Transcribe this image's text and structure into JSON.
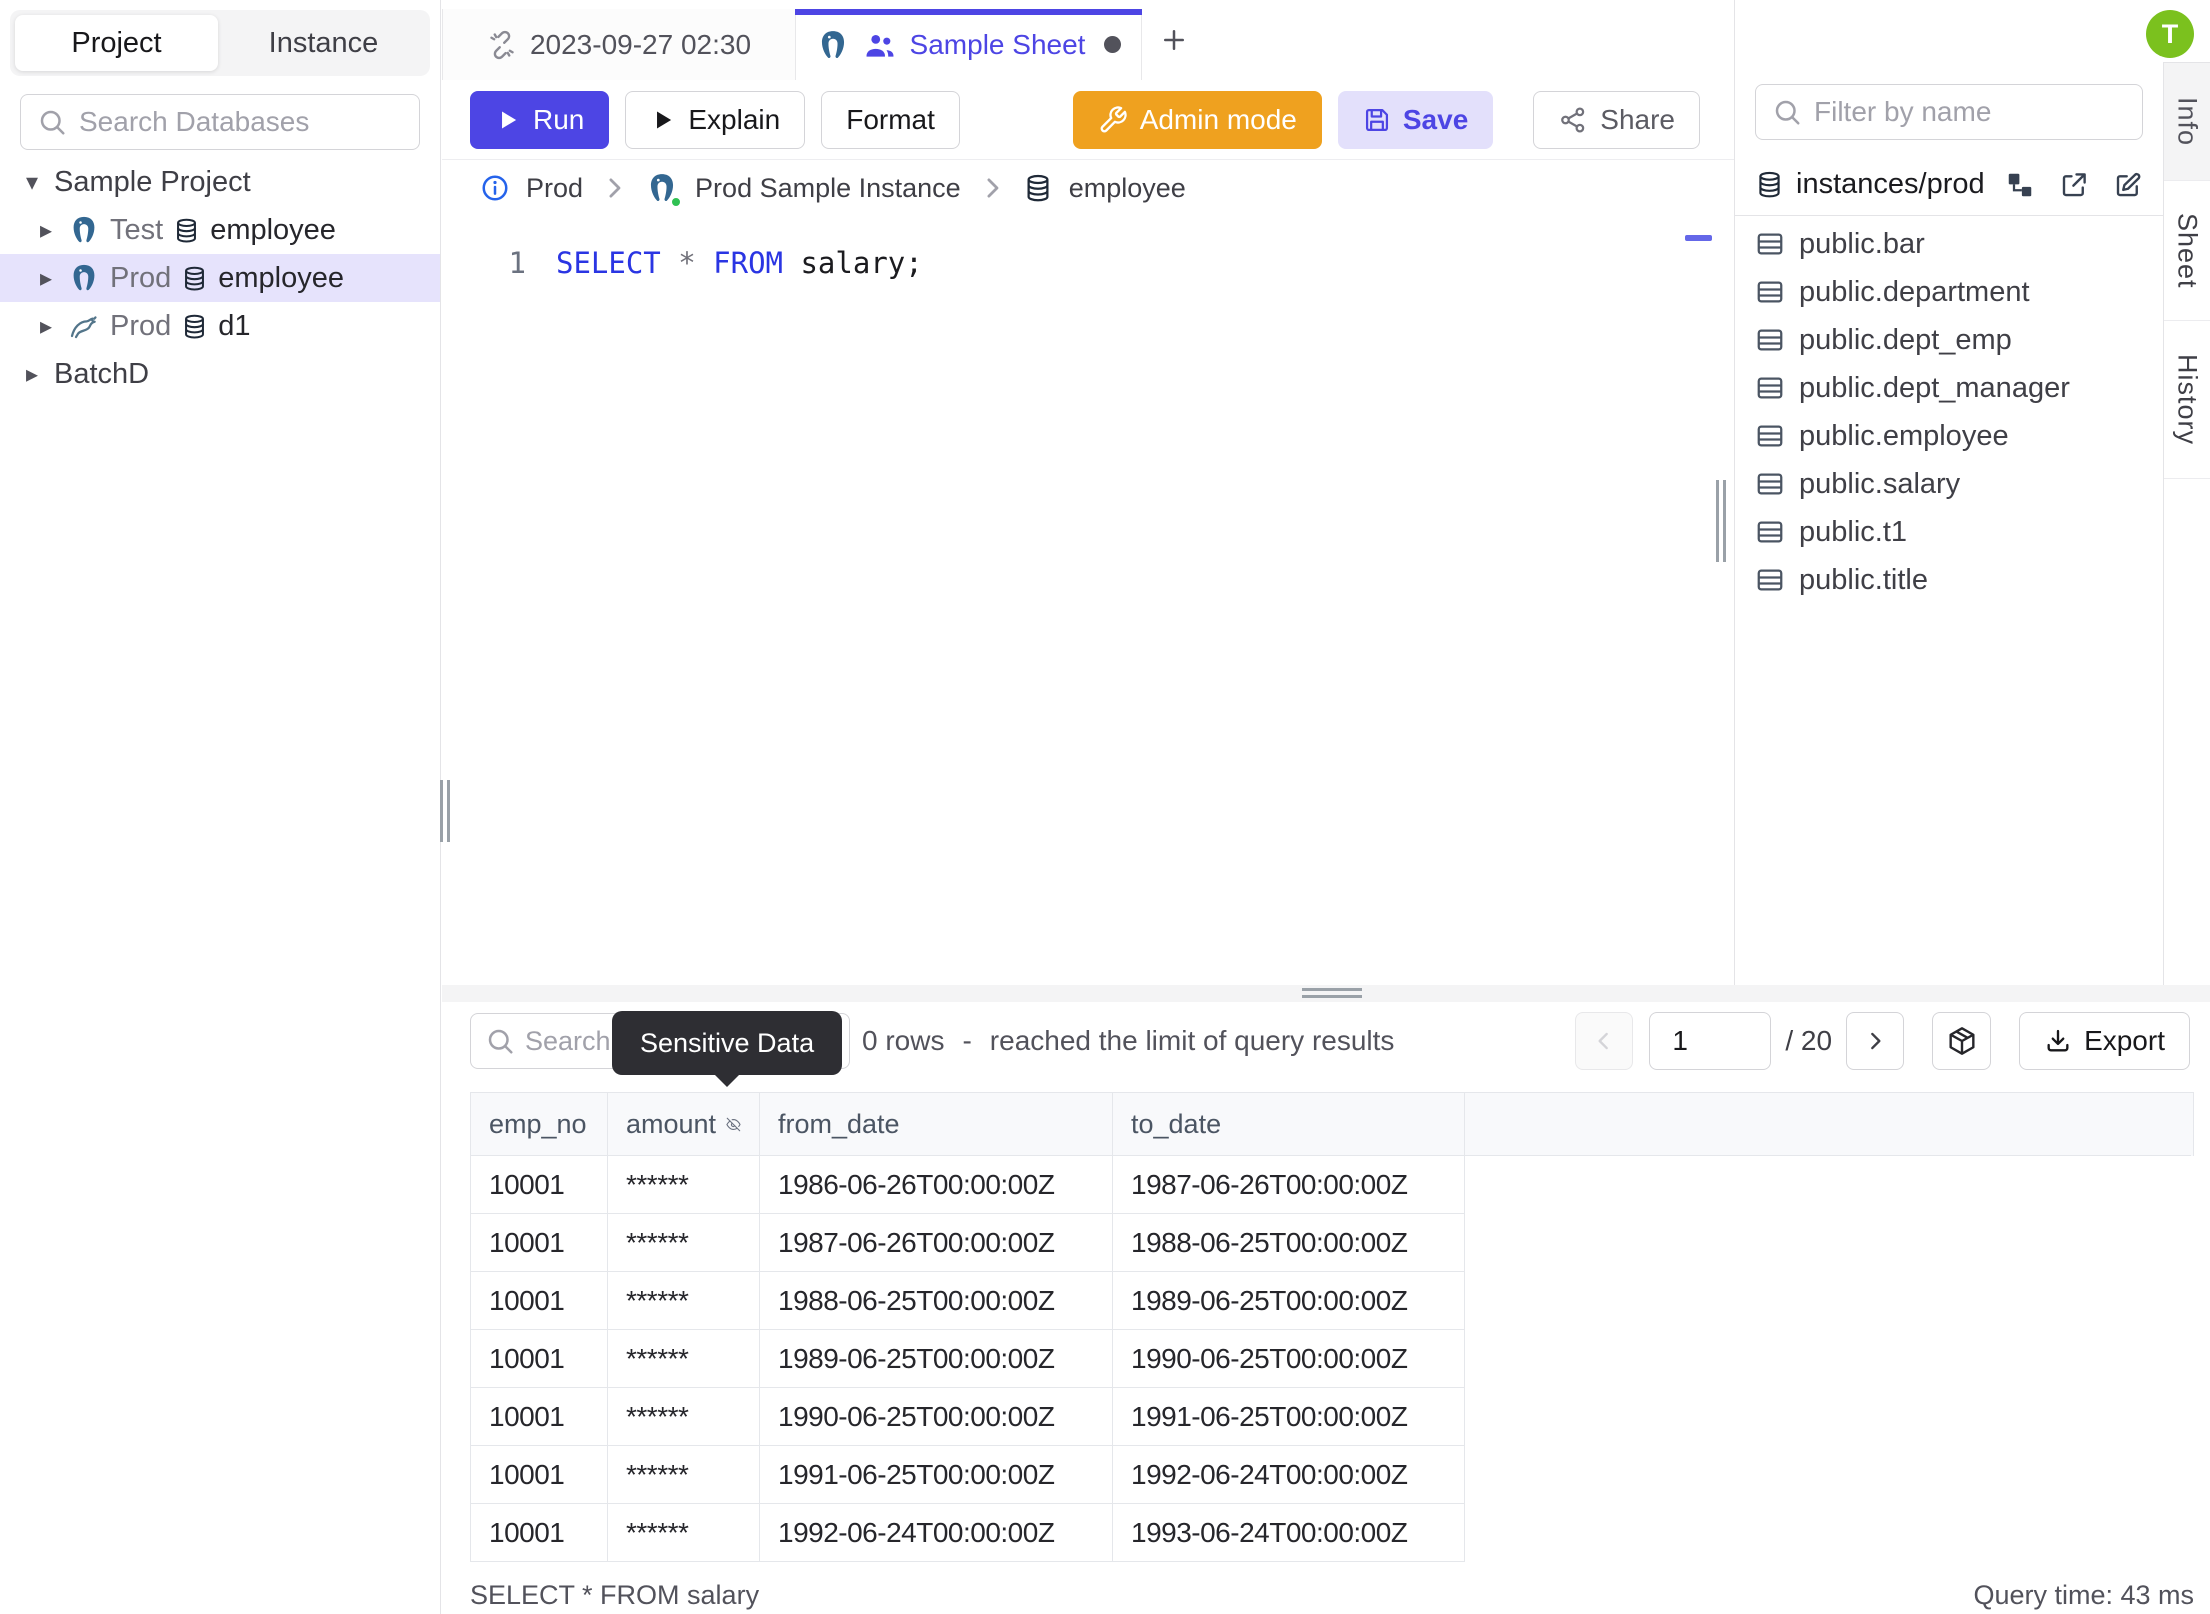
{
  "sidebar": {
    "tabs": [
      {
        "label": "Project"
      },
      {
        "label": "Instance"
      }
    ],
    "search_placeholder": "Search Databases",
    "tree": [
      {
        "kind": "project",
        "label": "Sample Project",
        "caret": "down"
      },
      {
        "kind": "database",
        "engine": "postgres",
        "env": "Test",
        "db": "employee"
      },
      {
        "kind": "database",
        "engine": "postgres",
        "env": "Prod",
        "db": "employee",
        "selected": true
      },
      {
        "kind": "database",
        "engine": "mysql",
        "env": "Prod",
        "db": "d1"
      },
      {
        "kind": "project",
        "label": "BatchD",
        "caret": "right"
      }
    ]
  },
  "tab_bar": {
    "history_tab": "2023-09-27 02:30",
    "active_tab": "Sample Sheet"
  },
  "toolbar": {
    "run": "Run",
    "explain": "Explain",
    "format": "Format",
    "admin_mode": "Admin mode",
    "save": "Save",
    "share": "Share"
  },
  "breadcrumb": [
    "Prod",
    "Prod Sample Instance",
    "employee"
  ],
  "editor": {
    "line_number": "1",
    "tokens": [
      {
        "text": "SELECT",
        "type": "keyword"
      },
      {
        "text": " ",
        "type": "plain"
      },
      {
        "text": "*",
        "type": "operator"
      },
      {
        "text": " ",
        "type": "plain"
      },
      {
        "text": "FROM",
        "type": "keyword"
      },
      {
        "text": " salary;",
        "type": "plain"
      }
    ]
  },
  "right_panel": {
    "filter_placeholder": "Filter by name",
    "group": "instances/prod",
    "tables": [
      "public.bar",
      "public.department",
      "public.dept_emp",
      "public.dept_manager",
      "public.employee",
      "public.salary",
      "public.t1",
      "public.title"
    ],
    "side_tabs": [
      "Info",
      "Sheet",
      "History"
    ]
  },
  "avatar": {
    "initial": "T"
  },
  "results": {
    "search_placeholder": "Search",
    "tooltip": "Sensitive Data",
    "summary_rows": "0 rows",
    "summary_sep": "-",
    "summary_note": "reached the limit of query results",
    "page": "1",
    "page_total": "/ 20",
    "export_label": "Export",
    "columns": [
      {
        "name": "emp_no"
      },
      {
        "name": "amount",
        "masked": true
      },
      {
        "name": "from_date"
      },
      {
        "name": "to_date"
      },
      {
        "name": ""
      }
    ],
    "rows": [
      [
        "10001",
        "******",
        "1986-06-26T00:00:00Z",
        "1987-06-26T00:00:00Z"
      ],
      [
        "10001",
        "******",
        "1987-06-26T00:00:00Z",
        "1988-06-25T00:00:00Z"
      ],
      [
        "10001",
        "******",
        "1988-06-25T00:00:00Z",
        "1989-06-25T00:00:00Z"
      ],
      [
        "10001",
        "******",
        "1989-06-25T00:00:00Z",
        "1990-06-25T00:00:00Z"
      ],
      [
        "10001",
        "******",
        "1990-06-25T00:00:00Z",
        "1991-06-25T00:00:00Z"
      ],
      [
        "10001",
        "******",
        "1991-06-25T00:00:00Z",
        "1992-06-24T00:00:00Z"
      ],
      [
        "10001",
        "******",
        "1992-06-24T00:00:00Z",
        "1993-06-24T00:00:00Z"
      ]
    ],
    "status_query": "SELECT * FROM salary",
    "status_time": "Query time: 43 ms"
  },
  "colors": {
    "accent": "#4d45e4",
    "admin_orange": "#efa11f",
    "avatar_green": "#7bc11e",
    "selected_tree_row": "#e6e3fc",
    "sql_keyword": "#2a35e3",
    "tooltip_bg": "#2e2e33"
  }
}
